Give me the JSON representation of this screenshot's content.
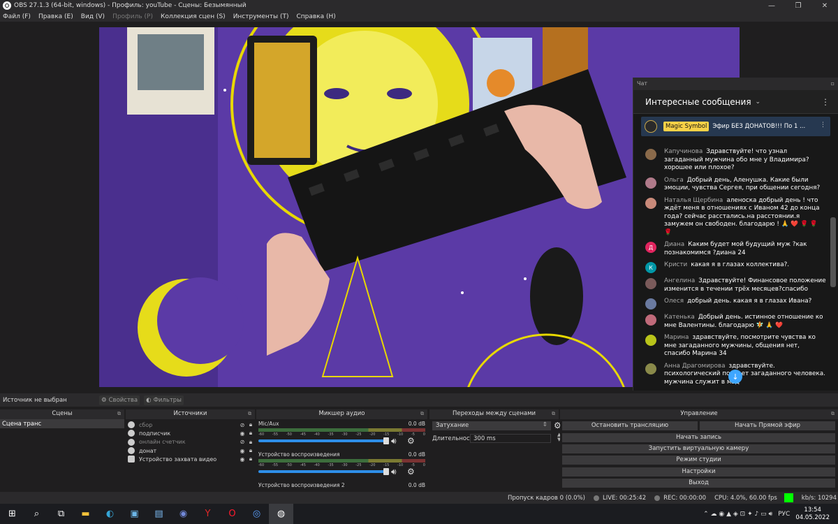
{
  "window": {
    "title": "OBS 27.1.3 (64-bit, windows) - Профиль: youTube - Сцены: Безымянный",
    "min": "—",
    "max": "❐",
    "close": "✕"
  },
  "menu": [
    {
      "label": "Файл (F)",
      "disabled": false
    },
    {
      "label": "Правка (E)",
      "disabled": false
    },
    {
      "label": "Вид (V)",
      "disabled": false
    },
    {
      "label": "Профиль (P)",
      "disabled": true
    },
    {
      "label": "Коллекция сцен (S)",
      "disabled": false
    },
    {
      "label": "Инструменты (T)",
      "disabled": false
    },
    {
      "label": "Справка (H)",
      "disabled": false
    }
  ],
  "chat": {
    "dock_title": "Чат",
    "header": "Интересные сообщения",
    "pinned": {
      "author": "Magic Symbol",
      "text": "Эфир БЕЗ ДОНАТОВ!!! По 1 ..."
    },
    "messages": [
      {
        "author": "Капучинова",
        "text": "Здравствуйте! что узнал загаданный мужчина обо мне у Владимира? хорошее или плохое?",
        "avatar": "#8a6a4a",
        "initial": ""
      },
      {
        "author": "Ольга",
        "text": "Добрый день, Аленушка. Какие были эмоции, чувства Сергея, при общении сегодня?",
        "avatar": "#b07a8a",
        "initial": ""
      },
      {
        "author": "Наталья Щербина",
        "text": "аленоска добрый день ! что ждёт меня в отношениях с Иваном 42 до конца года? сейчас расстались.на расстоянии.я замужем он свободен. благодарю ! 🙏 ❤️ 🌹 🌹 🌹",
        "avatar": "#c98a7a",
        "initial": ""
      },
      {
        "author": "Диана",
        "text": "Каким будет мой будущий муж ?как познакомимся ?диана 24",
        "avatar": "#e0245e",
        "initial": "Д"
      },
      {
        "author": "Кристи",
        "text": "какая я в глазах коллектива?.",
        "avatar": "#0097a7",
        "initial": "К"
      },
      {
        "author": "Ангелина",
        "text": "Здравствуйте! Финансовое положение изменится в течении трёх месяцев?спасибо",
        "avatar": "#7a5a5a",
        "initial": ""
      },
      {
        "author": "Олеся",
        "text": "добрый день. какая я в глазах Ивана?",
        "avatar": "#6a7aa0",
        "initial": ""
      },
      {
        "author": "Катенька",
        "text": "Добрый день. истинное отношение ко мне Валентины. благодарю 🧚 🙏 ❤️",
        "avatar": "#c06a7a",
        "initial": ""
      },
      {
        "author": "Марина",
        "text": "здравствуйте, посмотрите чувства ко мне загаданного мужчины, общения нет, спасибо Марина 34",
        "avatar": "#b9c41a",
        "initial": ""
      },
      {
        "author": "Анна Драгомирова",
        "text": "здравствуйте. психологический портрет загаданного человека. мужчина служит в мвд",
        "avatar": "#8a8a4a",
        "initial": ""
      }
    ]
  },
  "source_bar": {
    "label": "Источник не выбран",
    "properties": "Свойства",
    "filters": "Фильтры"
  },
  "docks": {
    "scenes": {
      "title": "Сцены",
      "items": [
        "Сцена транс"
      ]
    },
    "sources": {
      "title": "Источники",
      "items": [
        {
          "label": "сбор",
          "visible": false
        },
        {
          "label": "подписчик",
          "visible": true
        },
        {
          "label": "онлайн счетчик",
          "visible": false
        },
        {
          "label": "донат",
          "visible": true
        },
        {
          "label": "Устройство захвата видео",
          "visible": true
        }
      ]
    },
    "mixer": {
      "title": "Микшер аудио",
      "channels": [
        {
          "name": "Mic/Aux",
          "db": "0.0 dB",
          "volume": 0.95
        },
        {
          "name": "Устройство воспроизведения",
          "db": "0.0 dB",
          "volume": 0.95
        },
        {
          "name": "Устройство воспроизведения 2",
          "db": "0.0 dB",
          "volume": 0.95
        }
      ],
      "scale": [
        "-60",
        "-55",
        "-50",
        "-45",
        "-40",
        "-35",
        "-30",
        "-25",
        "-20",
        "-15",
        "-10",
        "-5",
        "0"
      ]
    },
    "transitions": {
      "title": "Переходы между сценами",
      "selected": "Затухание",
      "duration_label": "Длительность",
      "duration_value": "300 ms"
    },
    "controls": {
      "title": "Управление",
      "stop_stream": "Остановить трансляцию",
      "start_live": "Начать Прямой эфир",
      "start_record": "Начать запись",
      "virtual_cam": "Запустить виртуальную камеру",
      "studio": "Режим студии",
      "settings": "Настройки",
      "exit": "Выход"
    }
  },
  "status": {
    "dropped": "Пропуск кадров 0 (0.0%)",
    "live": "LIVE: 00:25:42",
    "rec": "REC: 00:00:00",
    "cpu": "CPU: 4.0%, 60.00 fps",
    "kbs": "kb/s: 10294"
  },
  "taskbar": {
    "lang": "РУС",
    "time": "13:54",
    "date": "04.05.2022"
  }
}
